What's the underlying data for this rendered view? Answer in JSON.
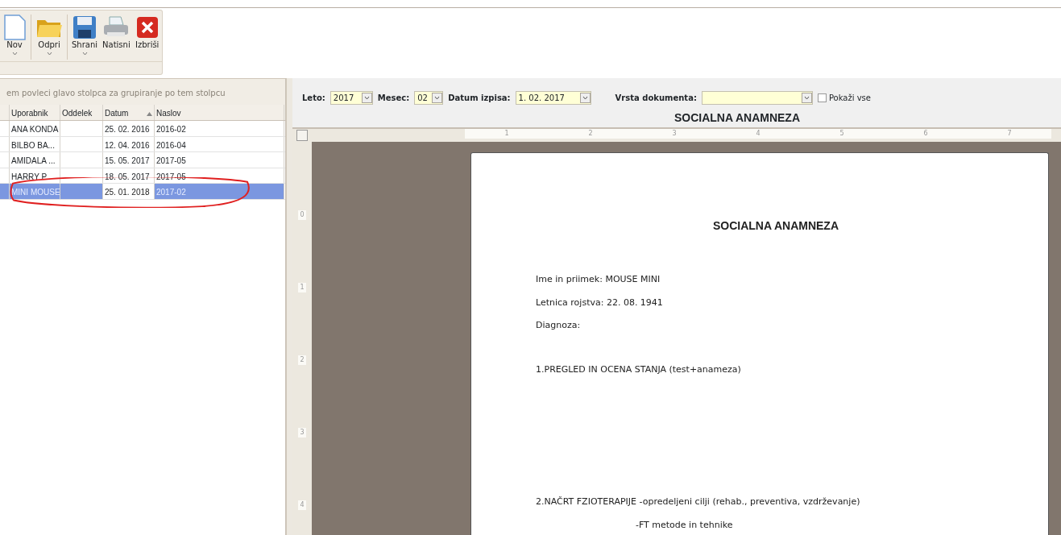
{
  "toolbar": {
    "buttons": [
      {
        "label": "Nov",
        "dropdown": true
      },
      {
        "label": "Odpri",
        "dropdown": true
      },
      {
        "label": "Shrani",
        "dropdown": true
      },
      {
        "label": "Natisni",
        "dropdown": false
      },
      {
        "label": "Izbriši",
        "dropdown": false
      }
    ]
  },
  "group_hint": "em povleci glavo stolpca za grupiranje po tem stolpcu",
  "table": {
    "columns": [
      {
        "label": "Uporabnik",
        "sorted": false
      },
      {
        "label": "Oddelek",
        "sorted": false
      },
      {
        "label": "Datum",
        "sorted": true
      },
      {
        "label": "Naslov",
        "sorted": false
      }
    ],
    "rows": [
      {
        "cells": [
          "ANA KONDA",
          "",
          "25. 02. 2016",
          "2016-02"
        ],
        "selected": false
      },
      {
        "cells": [
          "BILBO  BA...",
          "",
          "12. 04. 2016",
          "2016-04"
        ],
        "selected": false
      },
      {
        "cells": [
          "AMIDALA ...",
          "",
          "15. 05. 2017",
          "2017-05"
        ],
        "selected": false
      },
      {
        "cells": [
          "HARRY P",
          "",
          "18. 05. 2017",
          "2017-05"
        ],
        "selected": false
      },
      {
        "cells": [
          "MINI MOUSE",
          "",
          "25. 01. 2018",
          "2017-02"
        ],
        "selected": true
      }
    ]
  },
  "filters": {
    "leto_label": "Leto:",
    "leto": "2017",
    "mesec_label": "Mesec:",
    "mesec": "02",
    "datum_label": "Datum izpisa:",
    "datum": "1. 02. 2017",
    "vrsta_label": "Vrsta dokumenta:",
    "pokazi_label": "Pokaži vse",
    "pokazi_checked": false
  },
  "document_heading": "SOCIALNA ANAMNEZA",
  "ruler": {
    "horizontal": [
      "1",
      "2",
      "3",
      "4",
      "5",
      "6",
      "7"
    ],
    "vertical": [
      "0",
      "1",
      "2",
      "3",
      "4"
    ]
  },
  "document": {
    "lines": [
      {
        "kind": "title",
        "text": "SOCIALNA ANAMNEZA"
      },
      {
        "kind": "line",
        "text": "Ime in priimek: MOUSE MINI"
      },
      {
        "kind": "line",
        "text": "Letnica rojstva: 22. 08. 1941"
      },
      {
        "kind": "line",
        "text": "Diagnoza:"
      },
      {
        "kind": "section",
        "text": "1.PREGLED IN OCENA STANJA (test+anameza)"
      },
      {
        "kind": "section2",
        "text": "2.NAČRT FZIOTERAPIJE -opredeljeni cilji (rehab., preventiva, vzdrževanje)"
      },
      {
        "kind": "indented",
        "text": "-FT metode in tehnike"
      }
    ]
  }
}
